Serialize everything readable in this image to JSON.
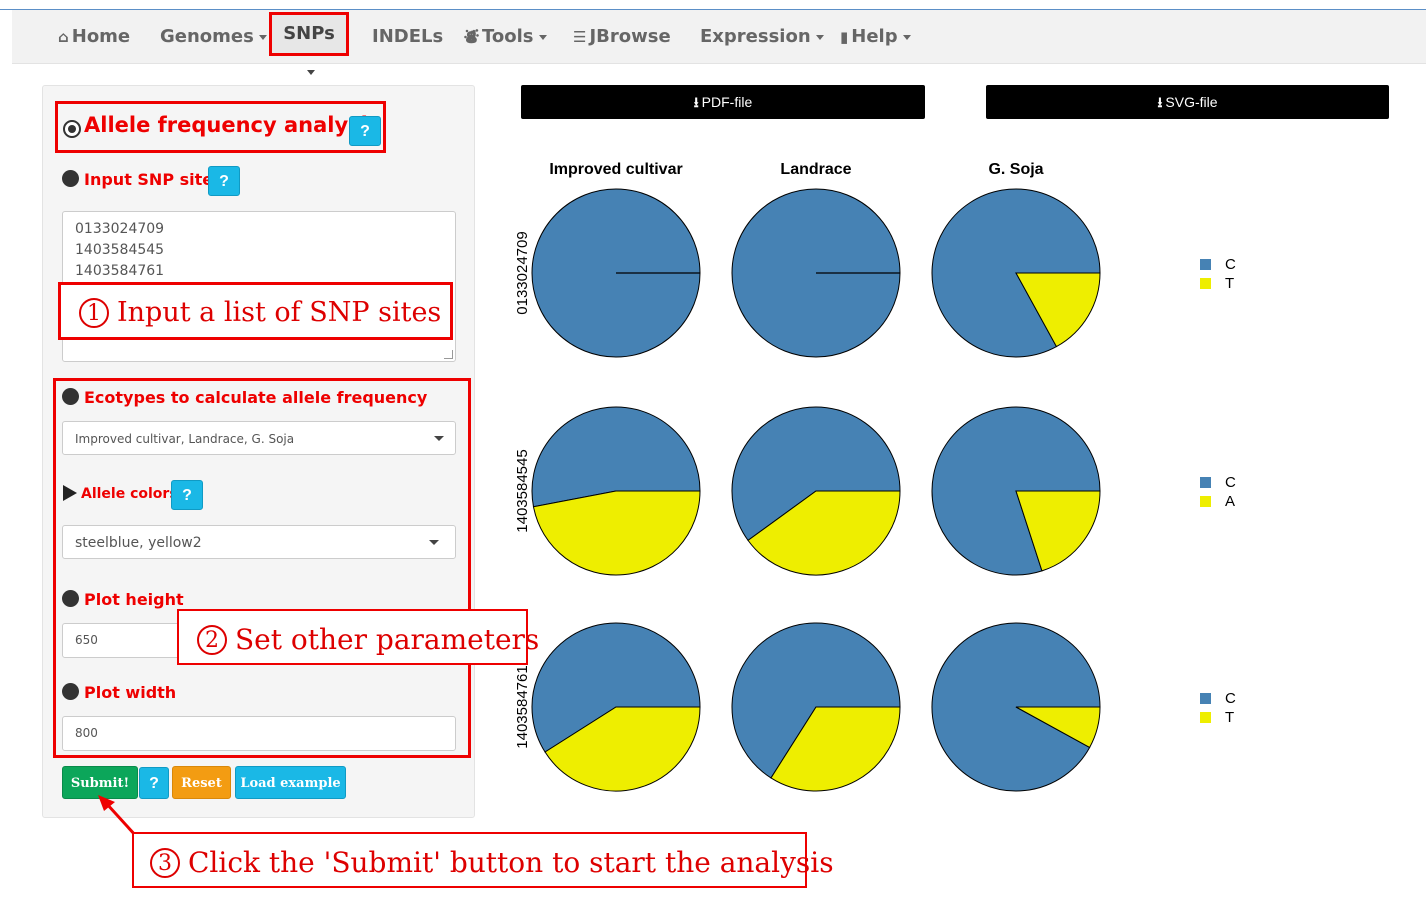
{
  "nav": {
    "home": "Home",
    "genomes": "Genomes",
    "snps": "SNPs",
    "indels": "INDELs",
    "tools": "Tools",
    "jbrowse": "JBrowse",
    "expression": "Expression",
    "help": "Help"
  },
  "form": {
    "title": "Allele frequency analysis",
    "input_label": "Input SNP sites",
    "snp_sites": [
      "0133024709",
      "1403584545",
      "1403584761"
    ],
    "ecotypes_label": "Ecotypes to calculate allele frequency",
    "ecotypes_value": "Improved cultivar, Landrace, G. Soja",
    "colors_label": "Allele colors",
    "colors_value": "steelblue, yellow2",
    "height_label": "Plot height",
    "height_value": "650",
    "width_label": "Plot width",
    "width_value": "800",
    "help_label": "?",
    "submit_label": "Submit!",
    "reset_label": "Reset",
    "example_label": "Load example"
  },
  "annotations": {
    "step1": "Input a list of SNP sites",
    "step2": "Set other parameters",
    "step3": "Click the 'Submit' button to start the analysis",
    "num1": "1",
    "num2": "2",
    "num3": "3"
  },
  "downloads": {
    "pdf_label": "PDF-file",
    "svg_label": "SVG-file",
    "icon": "download-icon"
  },
  "colors": {
    "steelblue": "#4682b4",
    "yellow2": "#eeee00",
    "accent_red": "#e00000",
    "submit_green": "#0ca65a",
    "reset_orange": "#f39c12",
    "info_blue": "#1ab8e6"
  },
  "chart_data": {
    "type": "pie",
    "columns": [
      "Improved cultivar",
      "Landrace",
      "G. Soja"
    ],
    "rows": [
      {
        "site": "0133024709",
        "alleles": [
          "C",
          "T"
        ],
        "fractions": [
          [
            1.0,
            0.0
          ],
          [
            1.0,
            0.0
          ],
          [
            0.83,
            0.17
          ]
        ]
      },
      {
        "site": "1403584545",
        "alleles": [
          "C",
          "A"
        ],
        "fractions": [
          [
            0.53,
            0.47
          ],
          [
            0.6,
            0.4
          ],
          [
            0.8,
            0.2
          ]
        ]
      },
      {
        "site": "1403584761",
        "alleles": [
          "C",
          "T"
        ],
        "fractions": [
          [
            0.59,
            0.41
          ],
          [
            0.66,
            0.34
          ],
          [
            0.92,
            0.08
          ]
        ]
      }
    ]
  }
}
